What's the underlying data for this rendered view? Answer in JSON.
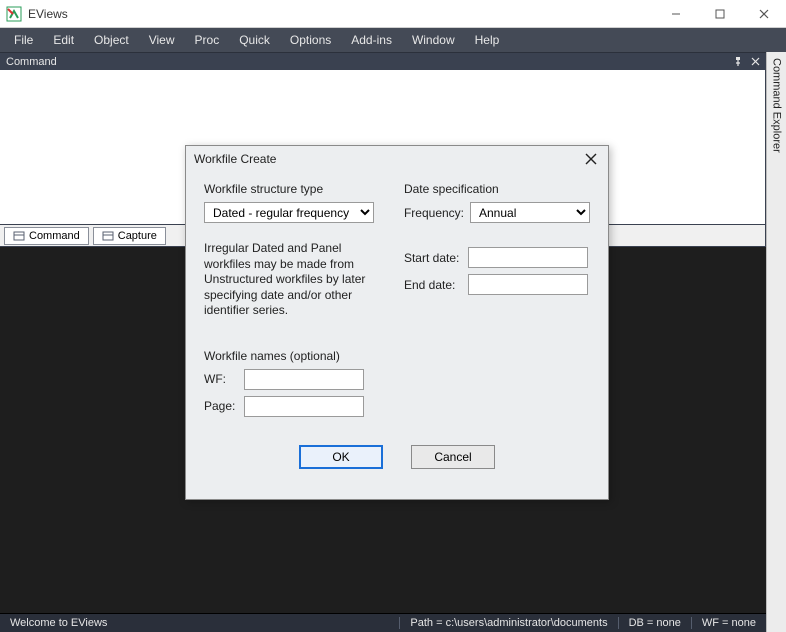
{
  "app": {
    "title": "EViews"
  },
  "menus": [
    "File",
    "Edit",
    "Object",
    "View",
    "Proc",
    "Quick",
    "Options",
    "Add-ins",
    "Window",
    "Help"
  ],
  "panel": {
    "command_label": "Command"
  },
  "tabs": {
    "command": "Command",
    "capture": "Capture"
  },
  "explorer": {
    "label": "Command Explorer"
  },
  "status": {
    "welcome": "Welcome to EViews",
    "path": "Path = c:\\users\\administrator\\documents",
    "db": "DB = none",
    "wf": "WF = none"
  },
  "dialog": {
    "title": "Workfile Create",
    "structure": {
      "label": "Workfile structure type",
      "value": "Dated - regular frequency",
      "hint": "Irregular Dated and Panel workfiles may be made from Unstructured workfiles by later specifying date and/or other identifier series."
    },
    "datespec": {
      "label": "Date specification",
      "freq_label": "Frequency:",
      "freq_value": "Annual",
      "start_label": "Start date:",
      "start_value": "",
      "end_label": "End date:",
      "end_value": ""
    },
    "names": {
      "label": "Workfile names (optional)",
      "wf_label": "WF:",
      "wf_value": "",
      "page_label": "Page:",
      "page_value": ""
    },
    "buttons": {
      "ok": "OK",
      "cancel": "Cancel"
    }
  }
}
